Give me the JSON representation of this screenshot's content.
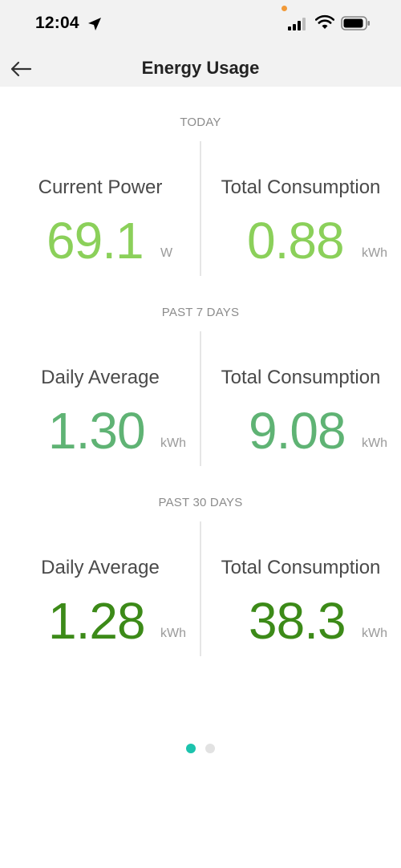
{
  "status_bar": {
    "time": "12:04",
    "icons": [
      "location-arrow-icon",
      "signal-icon",
      "wifi-icon",
      "battery-icon"
    ],
    "recording_dot_color": "#f29a38"
  },
  "header": {
    "title": "Energy Usage",
    "back_icon": "back-arrow-icon"
  },
  "sections": {
    "today": {
      "label": "TODAY",
      "left": {
        "title": "Current Power",
        "value": "69.1",
        "unit": "W",
        "color": "#8bd05a"
      },
      "right": {
        "title": "Total Consumption",
        "value": "0.88",
        "unit": "kWh",
        "color": "#8bd05a"
      }
    },
    "past7": {
      "label": "PAST 7 DAYS",
      "left": {
        "title": "Daily Average",
        "value": "1.30",
        "unit": "kWh",
        "color": "#5fb374"
      },
      "right": {
        "title": "Total Consumption",
        "value": "9.08",
        "unit": "kWh",
        "color": "#5fb374"
      }
    },
    "past30": {
      "label": "PAST 30 DAYS",
      "left": {
        "title": "Daily Average",
        "value": "1.28",
        "unit": "kWh",
        "color": "#3c8a18"
      },
      "right": {
        "title": "Total Consumption",
        "value": "38.3",
        "unit": "kWh",
        "color": "#3c8a18"
      }
    }
  },
  "pager": {
    "pages": 2,
    "active_index": 0,
    "active_color": "#1cc3ad",
    "inactive_color": "#e2e2e2"
  }
}
